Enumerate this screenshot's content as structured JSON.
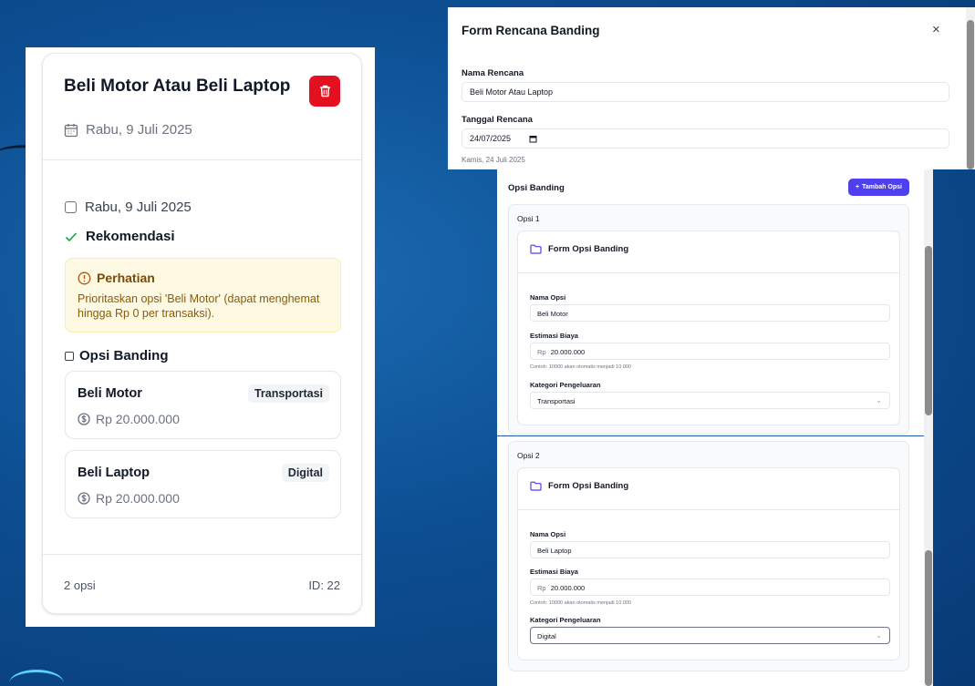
{
  "left_card": {
    "title": "Beli Motor Atau Beli Laptop",
    "date": "Rabu, 9 Juli 2025",
    "checkbox_date": "Rabu, 9 Juli 2025",
    "recommendation": "Rekomendasi",
    "alert": {
      "title": "Perhatian",
      "text": "Prioritaskan opsi 'Beli Motor' (dapat menghemat hingga Rp 0 per transaksi)."
    },
    "section_title": "Opsi Banding",
    "options": [
      {
        "name": "Beli Motor",
        "tag": "Transportasi",
        "price": "Rp 20.000.000"
      },
      {
        "name": "Beli Laptop",
        "tag": "Digital",
        "price": "Rp 20.000.000"
      }
    ],
    "footer_count": "2 opsi",
    "footer_id": "ID: 22"
  },
  "modal": {
    "title": "Form Rencana Banding",
    "close": "×",
    "name_label": "Nama Rencana",
    "name_value": "Beli Motor Atau Laptop",
    "date_label": "Tanggal Rencana",
    "date_value": "24/07/2025",
    "date_helper": "Kamis, 24 Juli 2025"
  },
  "panel": {
    "title": "Opsi Banding",
    "add_button": "Tambah Opsi",
    "options": [
      {
        "label": "Opsi 1",
        "form_title": "Form Opsi Banding",
        "name_label": "Nama Opsi",
        "name_value": "Beli Motor",
        "cost_label": "Estimasi Biaya",
        "currency": "Rp",
        "cost_value": "20.000.000",
        "cost_helper": "Contoh: 10000 akan otomatis menjadi 10.000",
        "category_label": "Kategori Pengeluaran",
        "category_value": "Transportasi"
      },
      {
        "label": "Opsi 2",
        "form_title": "Form Opsi Banding",
        "name_label": "Nama Opsi",
        "name_value": "Beli Laptop",
        "cost_label": "Estimasi Biaya",
        "currency": "Rp",
        "cost_value": "20.000.000",
        "cost_helper": "Contoh: 10000 akan otomatis menjadi 10.000",
        "category_label": "Kategori Pengeluaran",
        "category_value": "Digital"
      }
    ]
  },
  "colors": {
    "delete": "#e3101f",
    "accent": "#4f3ff0",
    "success": "#16a34a",
    "warning_bg": "#fef9e3",
    "warning_text": "#8a5a0b"
  },
  "icons": [
    "trash-icon",
    "calendar-icon",
    "check-icon",
    "alert-circle-icon",
    "dollar-circle-icon",
    "folder-icon",
    "close-icon",
    "plus-icon",
    "chevron-down-icon"
  ]
}
